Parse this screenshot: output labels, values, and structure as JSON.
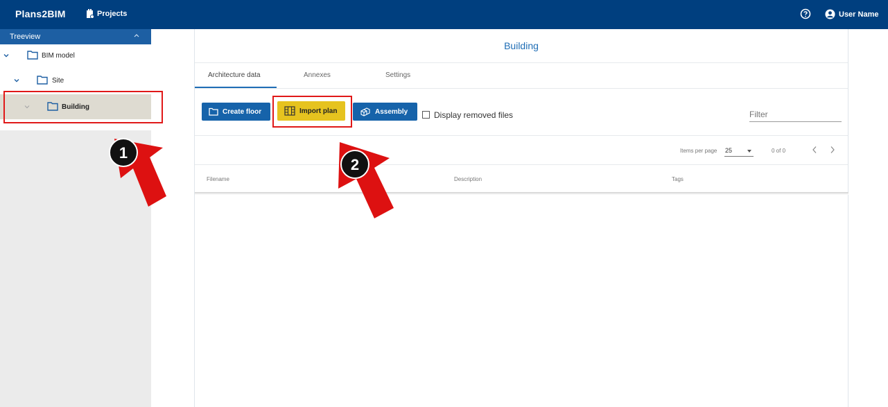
{
  "header": {
    "brand": "Plans2BIM",
    "projects_label": "Projects",
    "user_name": "User Name"
  },
  "sidebar": {
    "title": "Treeview",
    "items": [
      {
        "label": "BIM model",
        "level": 0,
        "expanded": true
      },
      {
        "label": "Site",
        "level": 1,
        "expanded": true
      },
      {
        "label": "Building",
        "level": 2,
        "expanded": true,
        "selected": true
      }
    ]
  },
  "main": {
    "title": "Building",
    "tabs": [
      {
        "label": "Architecture data",
        "active": true
      },
      {
        "label": "Annexes",
        "active": false
      },
      {
        "label": "Settings",
        "active": false
      }
    ],
    "toolbar": {
      "create_floor": "Create floor",
      "import_plan": "Import plan",
      "assembly": "Assembly",
      "display_removed_files": "Display removed files",
      "filter_placeholder": "Filter"
    },
    "pagination": {
      "items_per_page_label": "Items per page",
      "items_per_page_value": "25",
      "range": "0 of 0"
    },
    "table": {
      "columns": [
        "Filename",
        "Description",
        "Tags"
      ]
    }
  },
  "annotations": {
    "step1": "1",
    "step2": "2"
  },
  "colors": {
    "topbar": "#003f7f",
    "primary": "#1663aa",
    "highlight_button": "#e6c31f",
    "annotation_red": "#e01818"
  }
}
